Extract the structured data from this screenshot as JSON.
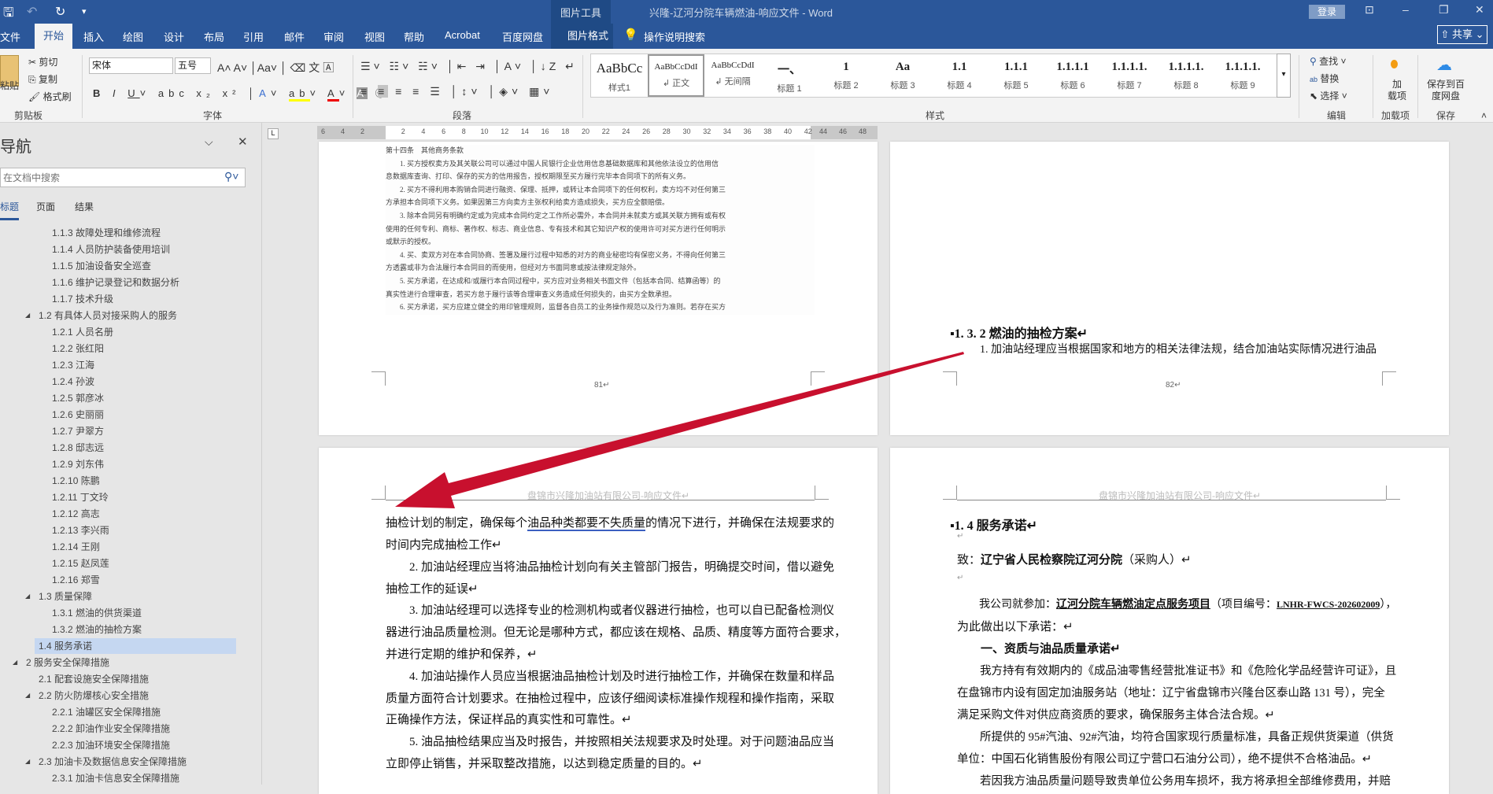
{
  "titlebar": {
    "context_tab": "图片工具",
    "title": "兴隆-辽河分院车辆燃油-响应文件 - Word",
    "login": "登录",
    "share": "共享"
  },
  "tabs": [
    "文件",
    "开始",
    "插入",
    "绘图",
    "设计",
    "布局",
    "引用",
    "邮件",
    "审阅",
    "视图",
    "帮助",
    "Acrobat",
    "百度网盘",
    "图片格式"
  ],
  "tell_me": "操作说明搜索",
  "ribbon": {
    "clipboard": {
      "paste": "粘贴",
      "cut": "剪切",
      "copy": "复制",
      "format_painter": "格式刷",
      "group": "剪贴板"
    },
    "font": {
      "name": "宋体",
      "size": "五号",
      "group": "字体"
    },
    "paragraph": {
      "group": "段落"
    },
    "styles": {
      "group": "样式",
      "items": [
        {
          "preview": "AaBbCc",
          "name": "样式1"
        },
        {
          "preview": "AaBbCcDdI",
          "name": "↲ 正文"
        },
        {
          "preview": "AaBbCcDdI",
          "name": "↲ 无间隔"
        },
        {
          "preview": "一、",
          "name": "标题 1"
        },
        {
          "preview": "1",
          "name": "标题 2"
        },
        {
          "preview": "Aa",
          "name": "标题 3"
        },
        {
          "preview": "1.1",
          "name": "标题 4"
        },
        {
          "preview": "1.1.1",
          "name": "标题 5"
        },
        {
          "preview": "1.1.1.1",
          "name": "标题 6"
        },
        {
          "preview": "1.1.1.1.",
          "name": "标题 7"
        },
        {
          "preview": "1.1.1.1.",
          "name": "标题 8"
        },
        {
          "preview": "1.1.1.1.",
          "name": "标题 9"
        }
      ]
    },
    "editing": {
      "find": "查找",
      "replace": "替换",
      "select": "选择",
      "group": "编辑"
    },
    "addins": {
      "label": "加载项",
      "button": "加\n载项"
    },
    "save": {
      "button": "保存到百度网盘",
      "group": "保存"
    }
  },
  "nav": {
    "title": "导航",
    "search_placeholder": "在文档中搜索",
    "tabs": [
      "标题",
      "页面",
      "结果"
    ],
    "items": [
      {
        "level": 3,
        "text": "1.1.3 故障处理和维修流程"
      },
      {
        "level": 3,
        "text": "1.1.4 人员防护装备使用培训"
      },
      {
        "level": 3,
        "text": "1.1.5 加油设备安全巡查"
      },
      {
        "level": 3,
        "text": "1.1.6 维护记录登记和数据分析"
      },
      {
        "level": 3,
        "text": "1.1.7 技术升级"
      },
      {
        "level": 2,
        "text": "1.2 有具体人员对接采购人的服务",
        "expanded": true
      },
      {
        "level": 3,
        "text": "1.2.1 人员名册"
      },
      {
        "level": 3,
        "text": "1.2.2 张红阳"
      },
      {
        "level": 3,
        "text": "1.2.3 江海"
      },
      {
        "level": 3,
        "text": "1.2.4 孙波"
      },
      {
        "level": 3,
        "text": "1.2.5 郭彦冰"
      },
      {
        "level": 3,
        "text": "1.2.6 史丽丽"
      },
      {
        "level": 3,
        "text": "1.2.7 尹翠方"
      },
      {
        "level": 3,
        "text": "1.2.8 邸志远"
      },
      {
        "level": 3,
        "text": "1.2.9 刘东伟"
      },
      {
        "level": 3,
        "text": "1.2.10 陈鹏"
      },
      {
        "level": 3,
        "text": "1.2.11 丁文玲"
      },
      {
        "level": 3,
        "text": "1.2.12 高志"
      },
      {
        "level": 3,
        "text": "1.2.13 李兴雨"
      },
      {
        "level": 3,
        "text": "1.2.14 王刚"
      },
      {
        "level": 3,
        "text": "1.2.15 赵凤莲"
      },
      {
        "level": 3,
        "text": "1.2.16 郑雪"
      },
      {
        "level": 2,
        "text": "1.3 质量保障",
        "expanded": true
      },
      {
        "level": 3,
        "text": "1.3.1 燃油的供货渠道"
      },
      {
        "level": 3,
        "text": "1.3.2 燃油的抽检方案"
      },
      {
        "level": 2,
        "text": "1.4 服务承诺",
        "selected": true
      },
      {
        "level": 1,
        "text": "2 服务安全保障措施",
        "expanded": true
      },
      {
        "level": 2,
        "text": "2.1 配套设施安全保障措施"
      },
      {
        "level": 2,
        "text": "2.2 防火防爆核心安全措施",
        "expanded": true
      },
      {
        "level": 3,
        "text": "2.2.1 油罐区安全保障措施"
      },
      {
        "level": 3,
        "text": "2.2.2 卸油作业安全保障措施"
      },
      {
        "level": 3,
        "text": "2.2.3 加油环境安全保障措施"
      },
      {
        "level": 2,
        "text": "2.3 加油卡及数据信息安全保障措施",
        "expanded": true
      },
      {
        "level": 3,
        "text": "2.3.1 加油卡信息安全保障措施"
      }
    ]
  },
  "ruler": {
    "left": [
      "6",
      "4",
      "2"
    ],
    "main": [
      "2",
      "4",
      "6",
      "8",
      "10",
      "12",
      "14",
      "16",
      "18",
      "20",
      "22",
      "24",
      "26",
      "28",
      "30",
      "32",
      "34",
      "36",
      "38",
      "40",
      "42"
    ],
    "right": [
      "44",
      "46",
      "48"
    ]
  },
  "pages": {
    "p81": {
      "number": "81↵",
      "scan_lines": [
        "第十四条　其他商务条款",
        "　　1. 买方授权卖方及其关联公司可以通过中国人民银行企业信用信息基础数据库和其他依法设立的信用信",
        "息数据库查询、打印、保存的买方的信用报告，授权期限至买方履行完毕本合同项下的所有义务。",
        "　　2. 买方不得利用本购销合同进行融资、保理、抵押，或转让本合同项下的任何权利，卖方均不对任何第三",
        "方承担本合同项下义务。如果因第三方向卖方主张权利给卖方造成损失，买方应全额赔偿。",
        "　　3. 除本合同另有明确约定或为完成本合同约定之工作所必需外，本合同并未就卖方或其关联方拥有或有权",
        "使用的任何专利、商标、著作权、标志、商业信息、专有技术和其它知识产权的使用许可对买方进行任何明示",
        "或默示的授权。",
        "　　4. 买、卖双方对在本合同协商、签署及履行过程中知悉的对方的商业秘密均有保密义务，不得向任何第三",
        "方透露或非为合法履行本合同目的而使用，但经对方书面同意或按法律规定除外。",
        "　　5. 买方承诺，在达成和/或履行本合同过程中，买方应对业务相关书面文件（包括本合同、结算函等）的",
        "真实性进行合理审查，若买方怠于履行该等合理审查义务造成任何损失的，由买方全数承担。",
        "　　6. 买方承诺，买方应建立健全的用印管理规则，监督各自员工的业务操作规范以及行为准则。若存在买方"
      ]
    },
    "p82": {
      "number": "82↵",
      "heading": "▪1. 3. 2 燃油的抽检方案↵",
      "line1": "1. 加油站经理应当根据国家和地方的相关法律法规，结合加油站实际情况进行油品"
    },
    "header": "盘锦市兴隆加油站有限公司-响应文件↵",
    "p83": {
      "l1a": "抽检计划的制定，确保每个",
      "l1u": "油品种类都要不失质量",
      "l1b": "的情况下进行，并确保在法规要求的",
      "lines": [
        "时间内完成抽检工作↵",
        "　　2. 加油站经理应当将油品抽检计划向有关主管部门报告，明确提交时间，借以避免",
        "抽检工作的延误↵",
        "　　3. 加油站经理可以选择专业的检测机构或者仪器进行抽检，也可以自已配备检测仪",
        "器进行油品质量检测。但无论是哪种方式，都应该在规格、品质、精度等方面符合要求，",
        "并进行定期的维护和保养，↵",
        "　　4. 加油站操作人员应当根据油品抽检计划及时进行抽检工作，并确保在数量和样品",
        "质量方面符合计划要求。在抽检过程中，应该仔细阅读标准操作规程和操作指南，采取",
        "正确操作方法，保证样品的真实性和可靠性。↵",
        "　　5. 油品抽检结果应当及时报告，并按照相关法规要求及时处理。对于问题油品应当",
        "立即停止销售，并采取整改措施，以达到稳定质量的目的。↵"
      ]
    },
    "p84": {
      "heading": "▪1. 4 服务承诺↵",
      "blank": "↵",
      "to_prefix": "致：",
      "to_name": "辽宁省人民检察院辽河分院",
      "to_suffix": "（采购人）↵",
      "p1a": "　　我公司就参加：",
      "p1_project": "辽河分院车辆燃油定点服务项目",
      "p1b": "（项目编号：",
      "p1_code": "LNHR-FWCS-202602009",
      "p1c": "），",
      "p1_line2": "为此做出以下承诺：↵",
      "sec1": "　　一、资质与油品质量承诺↵",
      "lines": [
        "　　我方持有有效期内的《成品油零售经营批准证书》和《危险化学品经营许可证》，且",
        "在盘锦市内设有固定加油服务站（地址：辽宁省盘锦市兴隆台区泰山路 131 号），完全",
        "满足采购文件对供应商资质的要求，确保服务主体合法合规。↵",
        "　　所提供的 95#汽油、92#汽油，均符合国家现行质量标准，具备正规供货渠道（供货",
        "单位：中国石化销售股份有限公司辽宁营口石油分公司），绝不提供不合格油品。↵",
        "　　若因我方油品质量问题导致贵单位公务用车损坏，我方将承担全部维修费用，并赔"
      ]
    }
  },
  "colors": {
    "brand": "#2b579a",
    "arrow": "#c8102e",
    "nav_selected": "#c5d7f1"
  }
}
